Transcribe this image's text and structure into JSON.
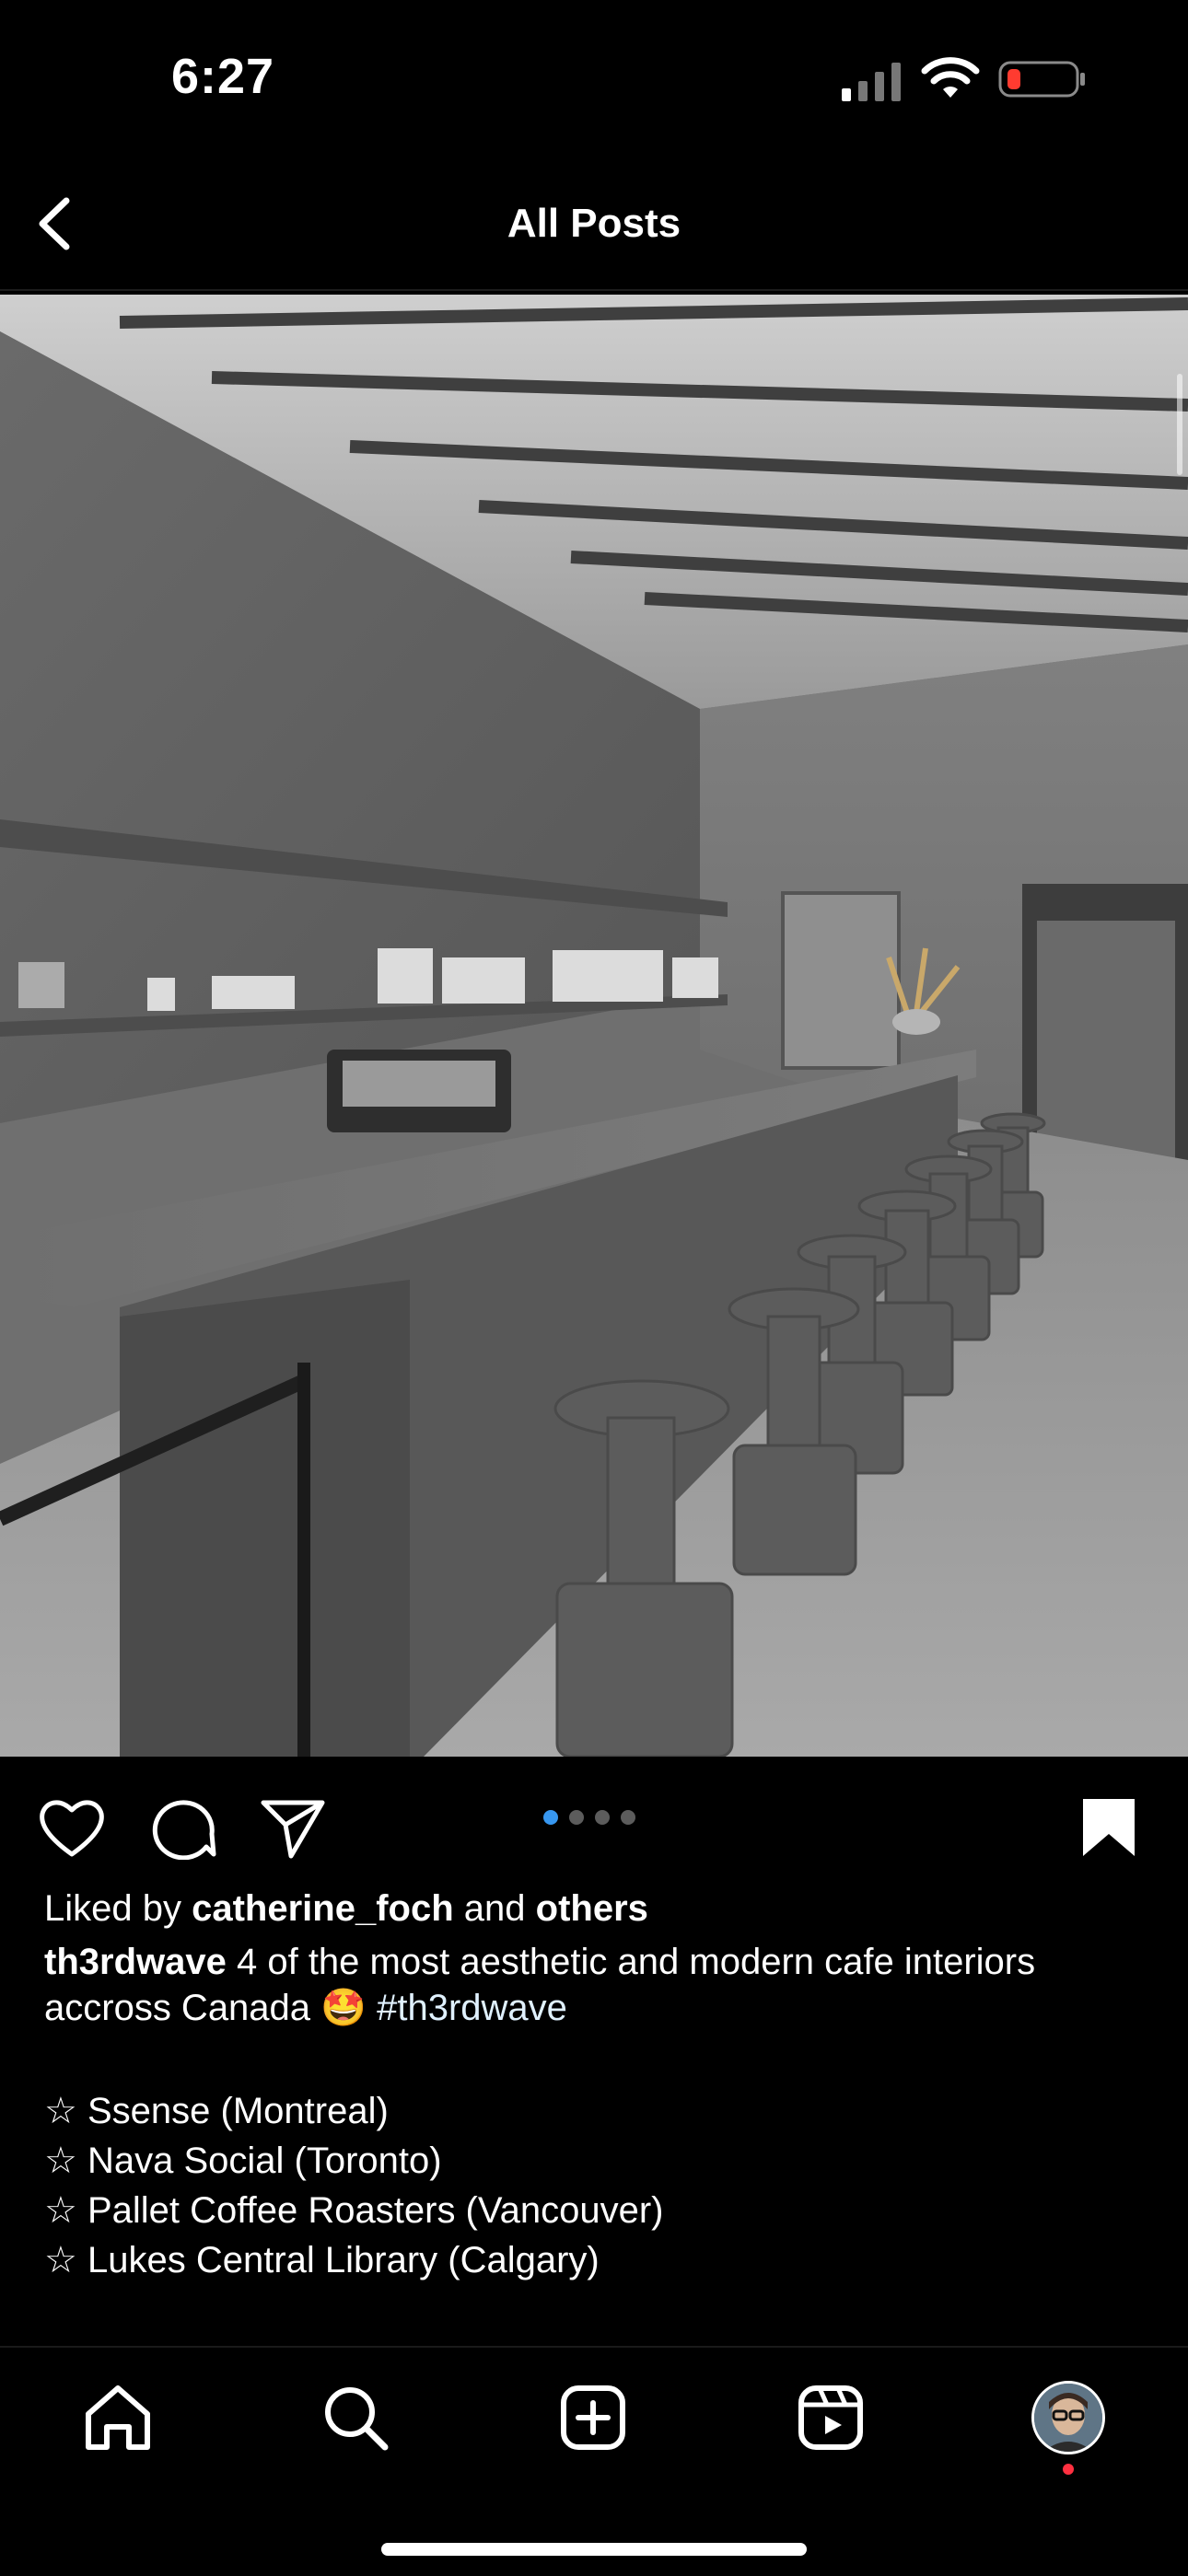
{
  "status_bar": {
    "time": "6:27",
    "signal_icon": "cellular-signal-icon",
    "wifi_icon": "wifi-icon",
    "battery_icon": "battery-low-icon",
    "battery_color": "#ff3b30"
  },
  "header": {
    "back_icon": "chevron-left-icon",
    "title": "All Posts"
  },
  "post": {
    "image_alt_icon": "photo",
    "carousel": {
      "count": 4,
      "active_index": 0,
      "active_color": "#3797f0"
    },
    "actions": {
      "like_icon": "heart-icon",
      "comment_icon": "comment-icon",
      "share_icon": "send-icon",
      "save_icon": "bookmark-icon"
    },
    "liked_by": {
      "prefix": "Liked by",
      "user": "catherine_foch",
      "middle": "and",
      "suffix": "others"
    },
    "caption": {
      "username": "th3rdwave",
      "text_line1": "4 of the most aesthetic and modern cafe interiors",
      "text_line2": "accross Canada",
      "emoji": "🤩",
      "hashtag": "#th3rdwave",
      "list": [
        "☆ Ssense (Montreal)",
        "☆ Nava Social (Toronto)",
        "☆ Pallet Coffee Roasters (Vancouver)",
        "☆ Lukes Central Library (Calgary)"
      ]
    }
  },
  "tabbar": {
    "home_icon": "home-icon",
    "search_icon": "search-icon",
    "create_icon": "plus-square-icon",
    "reels_icon": "reels-icon",
    "profile_icon": "avatar",
    "notification_color": "#ff3040"
  }
}
